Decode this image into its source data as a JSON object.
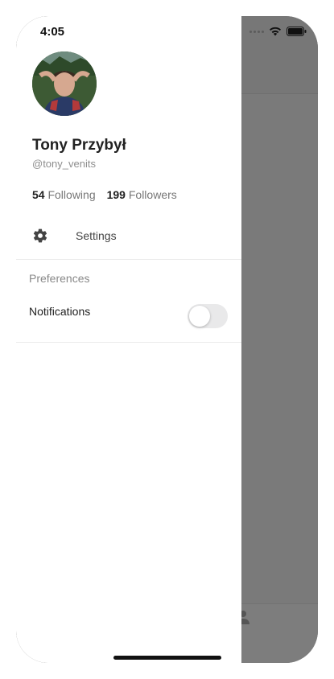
{
  "status_bar": {
    "time": "4:05"
  },
  "profile": {
    "name": "Tony Przybył",
    "handle": "@tony_venits",
    "following_count": "54",
    "following_label": "Following",
    "followers_count": "199",
    "followers_label": "Followers"
  },
  "menu": {
    "settings_label": "Settings",
    "settings_icon": "gear-icon"
  },
  "preferences": {
    "title": "Preferences",
    "notifications_label": "Notifications",
    "notifications_on": false
  },
  "background_tabbar": {
    "profile_label": "ofile",
    "profile_icon": "person-icon"
  },
  "colors": {
    "overlay": "#7a7a7a",
    "toggle_off": "#e9e9ea"
  }
}
